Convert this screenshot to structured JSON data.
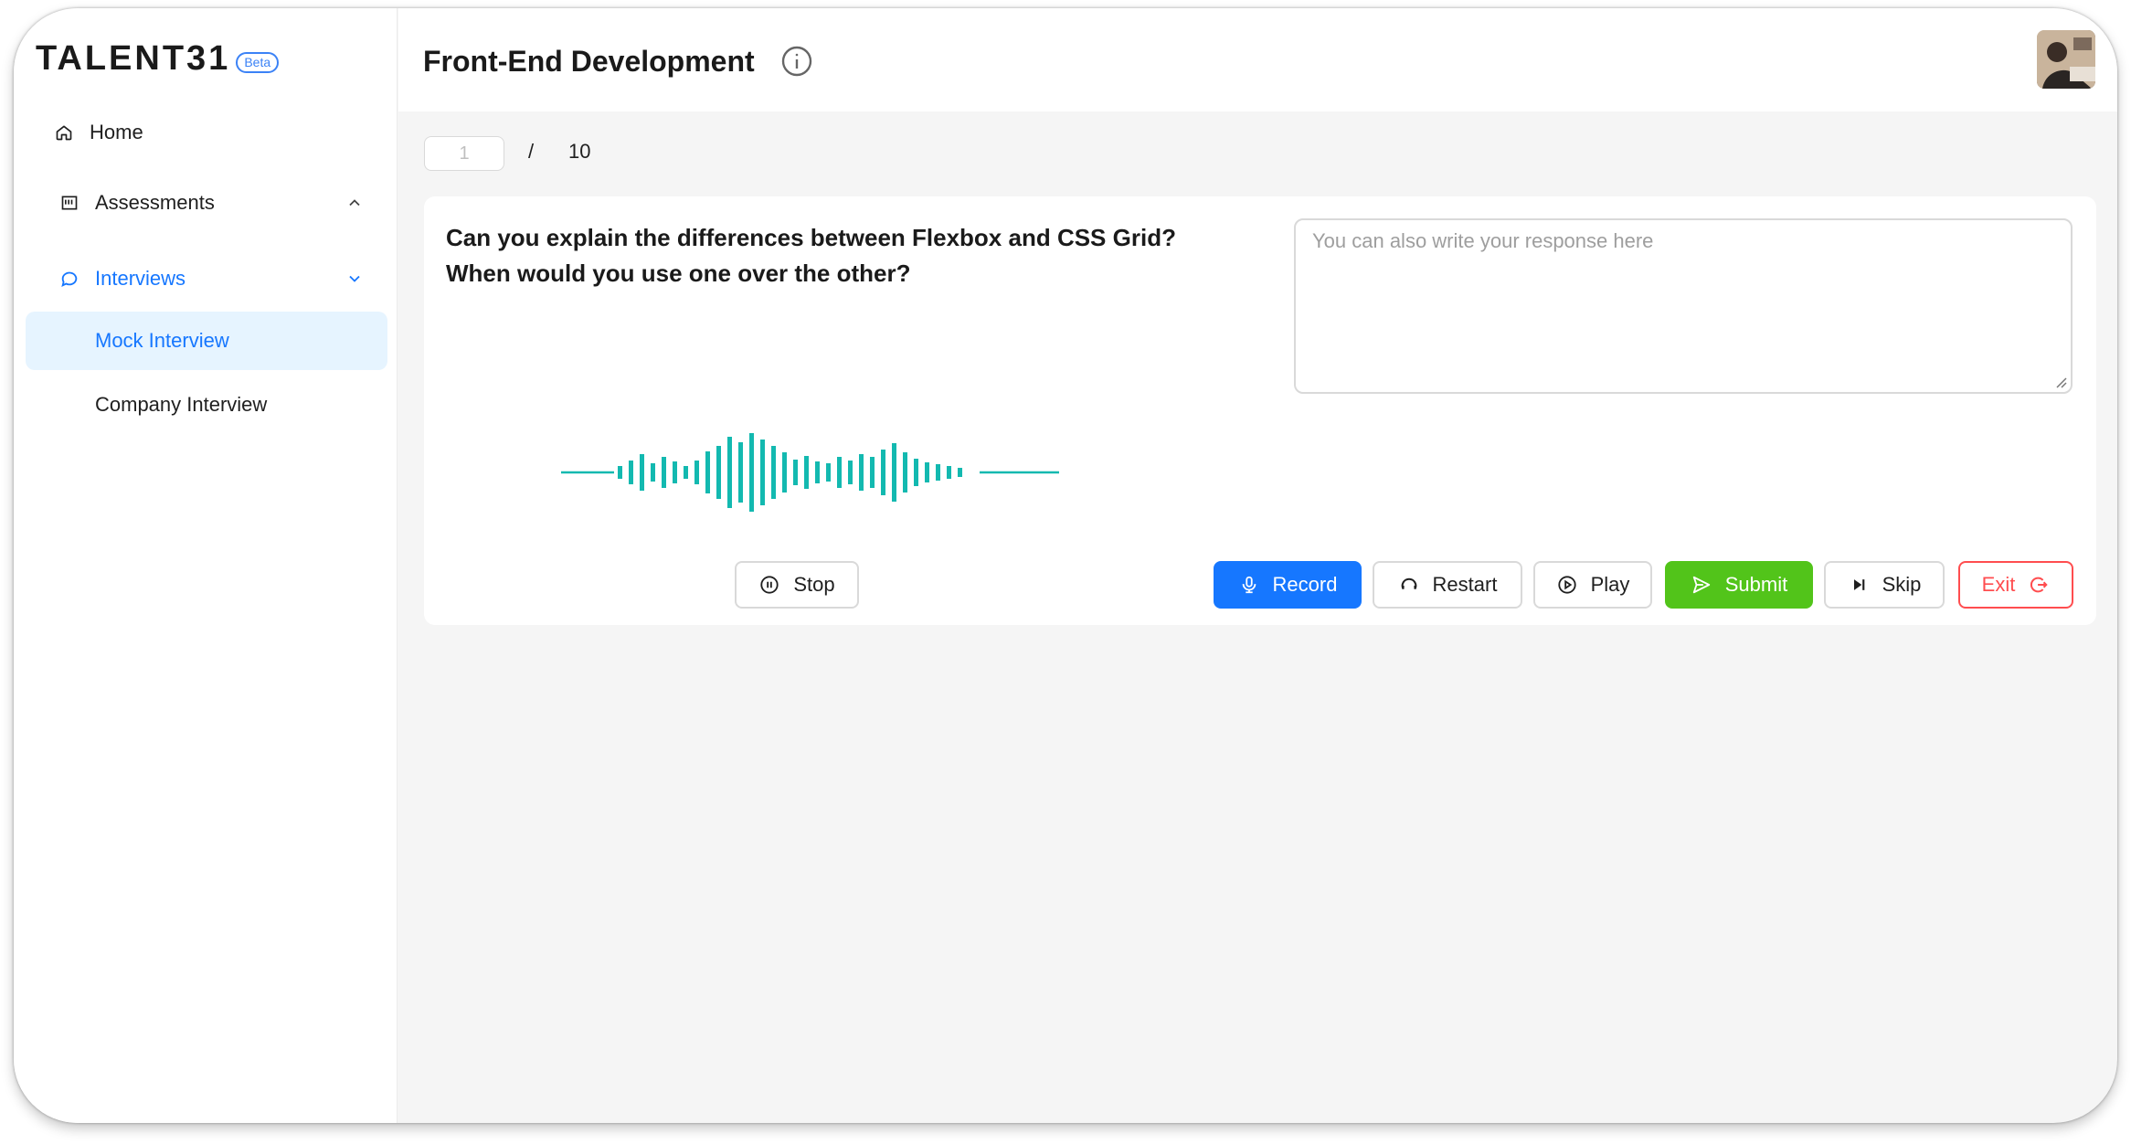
{
  "app": {
    "logo": "TALENT31",
    "badge": "Beta"
  },
  "sidebar": {
    "items": [
      {
        "label": "Home",
        "icon": "home-icon"
      },
      {
        "label": "Assessments",
        "icon": "assessment-icon",
        "expanded": true
      },
      {
        "label": "Interviews",
        "icon": "chat-icon",
        "expanded": true
      },
      {
        "label": "Mock Interview",
        "active": true
      },
      {
        "label": "Company Interview"
      }
    ]
  },
  "header": {
    "title": "Front-End Development",
    "info_icon": "info-icon",
    "avatar": "user-avatar"
  },
  "pager": {
    "current_placeholder": "1",
    "separator": "/",
    "total": "10"
  },
  "question": {
    "text": "Can you explain the differences between Flexbox and CSS Grid? When would you use one over the other?"
  },
  "response": {
    "placeholder": "You can also write your response here",
    "value": ""
  },
  "controls": {
    "stop_label": "Stop",
    "record_label": "Record",
    "restart_label": "Restart",
    "play_label": "Play",
    "submit_label": "Submit",
    "skip_label": "Skip",
    "exit_label": "Exit"
  },
  "colors": {
    "primary": "#1677ff",
    "success": "#52c41a",
    "danger": "#ff4d4f",
    "waveform": "#13b9b0",
    "active_bg": "#e6f4ff"
  }
}
